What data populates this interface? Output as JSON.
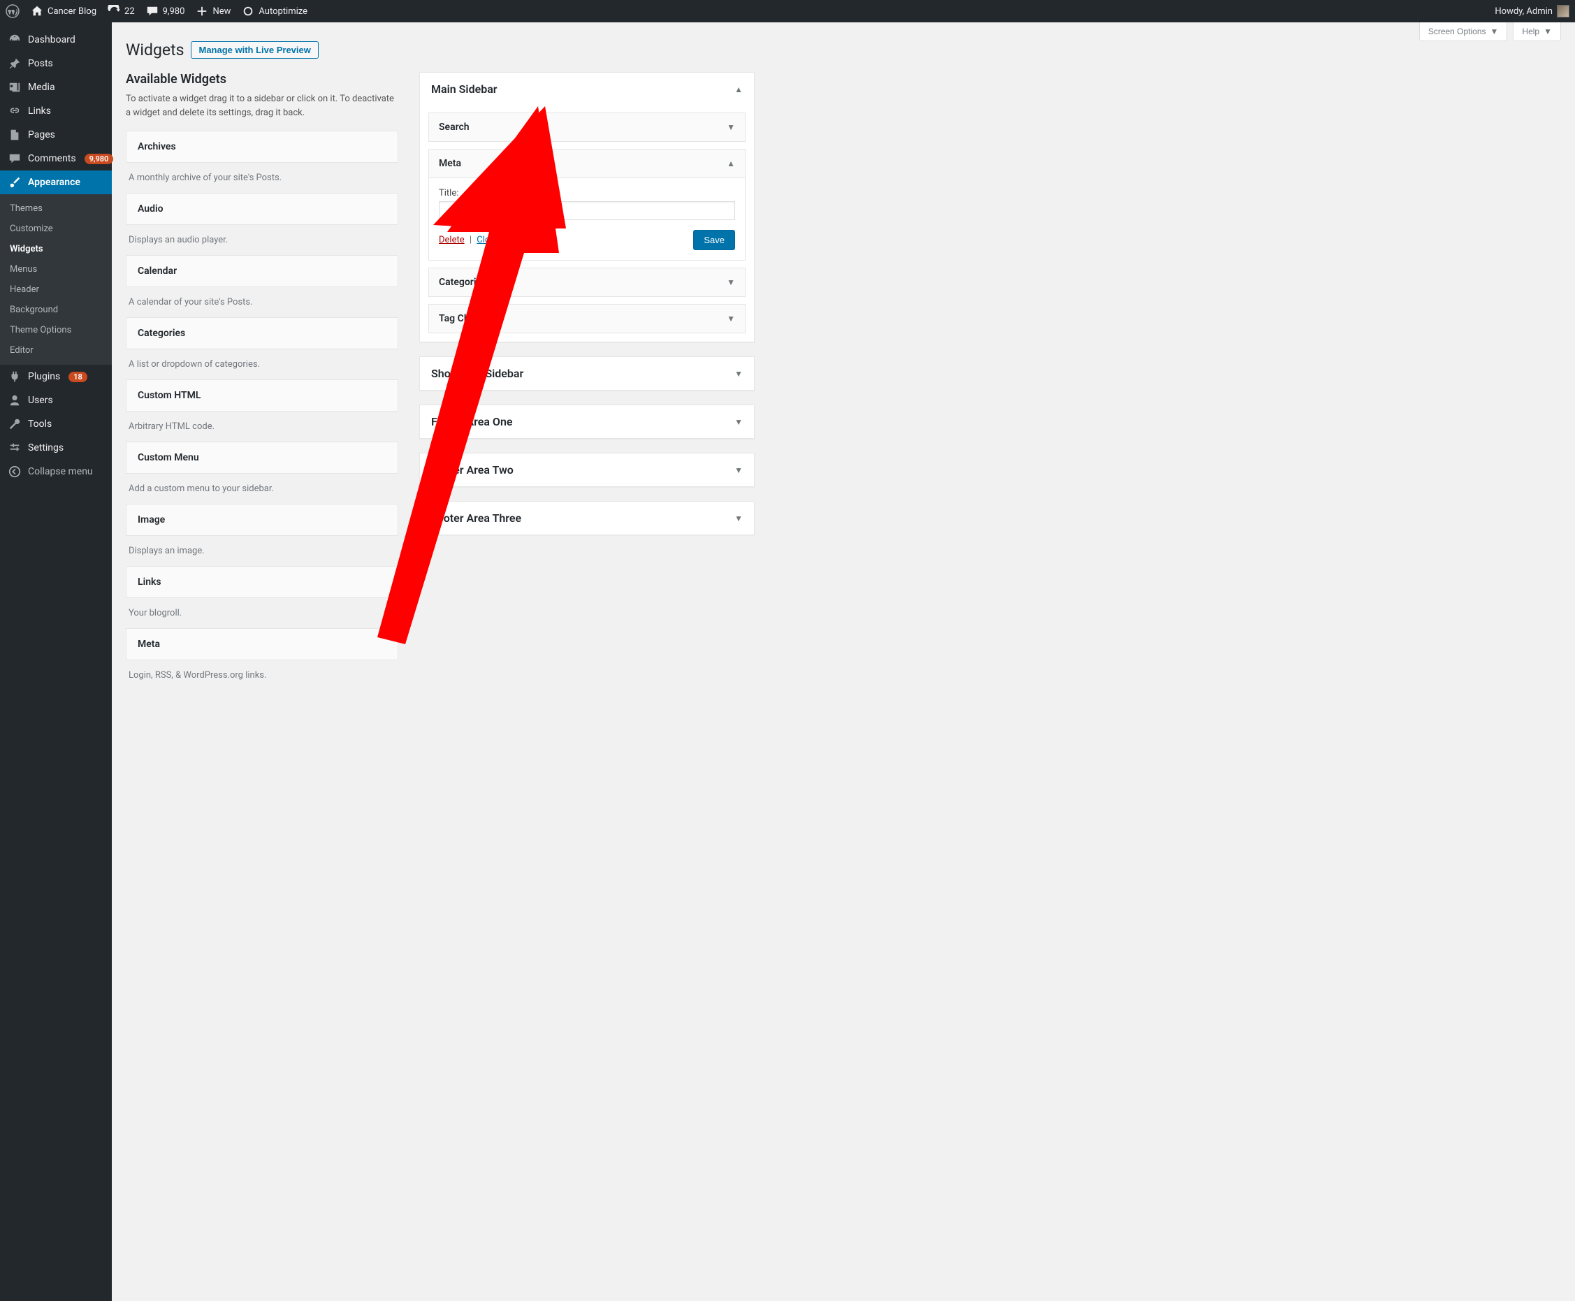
{
  "adminbar": {
    "site_name": "Cancer Blog",
    "updates_count": "22",
    "comments_count": "9,980",
    "new_label": "New",
    "autoptimize": "Autoptimize",
    "howdy": "Howdy, Admin"
  },
  "menu": {
    "dashboard": "Dashboard",
    "posts": "Posts",
    "media": "Media",
    "links": "Links",
    "pages": "Pages",
    "comments": "Comments",
    "comments_count": "9,980",
    "appearance": "Appearance",
    "plugins": "Plugins",
    "plugins_count": "18",
    "users": "Users",
    "tools": "Tools",
    "settings": "Settings",
    "collapse": "Collapse menu"
  },
  "appearance_submenu": {
    "themes": "Themes",
    "customize": "Customize",
    "widgets": "Widgets",
    "menus": "Menus",
    "header": "Header",
    "background": "Background",
    "theme_options": "Theme Options",
    "editor": "Editor"
  },
  "screen_meta": {
    "options": "Screen Options",
    "help": "Help"
  },
  "page": {
    "title": "Widgets",
    "preview_btn": "Manage with Live Preview",
    "available_title": "Available Widgets",
    "available_desc": "To activate a widget drag it to a sidebar or click on it. To deactivate a widget and delete its settings, drag it back."
  },
  "available_widgets": [
    {
      "name": "Archives",
      "desc": "A monthly archive of your site's Posts."
    },
    {
      "name": "Audio",
      "desc": "Displays an audio player."
    },
    {
      "name": "Calendar",
      "desc": "A calendar of your site's Posts."
    },
    {
      "name": "Categories",
      "desc": "A list or dropdown of categories."
    },
    {
      "name": "Custom HTML",
      "desc": "Arbitrary HTML code."
    },
    {
      "name": "Custom Menu",
      "desc": "Add a custom menu to your sidebar."
    },
    {
      "name": "Image",
      "desc": "Displays an image."
    },
    {
      "name": "Links",
      "desc": "Your blogroll."
    },
    {
      "name": "Meta",
      "desc": "Login, RSS, & WordPress.org links."
    }
  ],
  "sidebars": {
    "main": {
      "title": "Main Sidebar",
      "widgets": {
        "search": "Search",
        "meta": "Meta",
        "categories": "Categories",
        "tag_cloud": "Tag Cloud"
      },
      "meta_panel": {
        "title_label": "Title:",
        "title_value": "",
        "delete": "Delete",
        "close": "Close",
        "save": "Save"
      }
    },
    "showcase": "Showcase Sidebar",
    "footer1": "Footer Area One",
    "footer2": "Footer Area Two",
    "footer3": "Footer Area Three"
  }
}
